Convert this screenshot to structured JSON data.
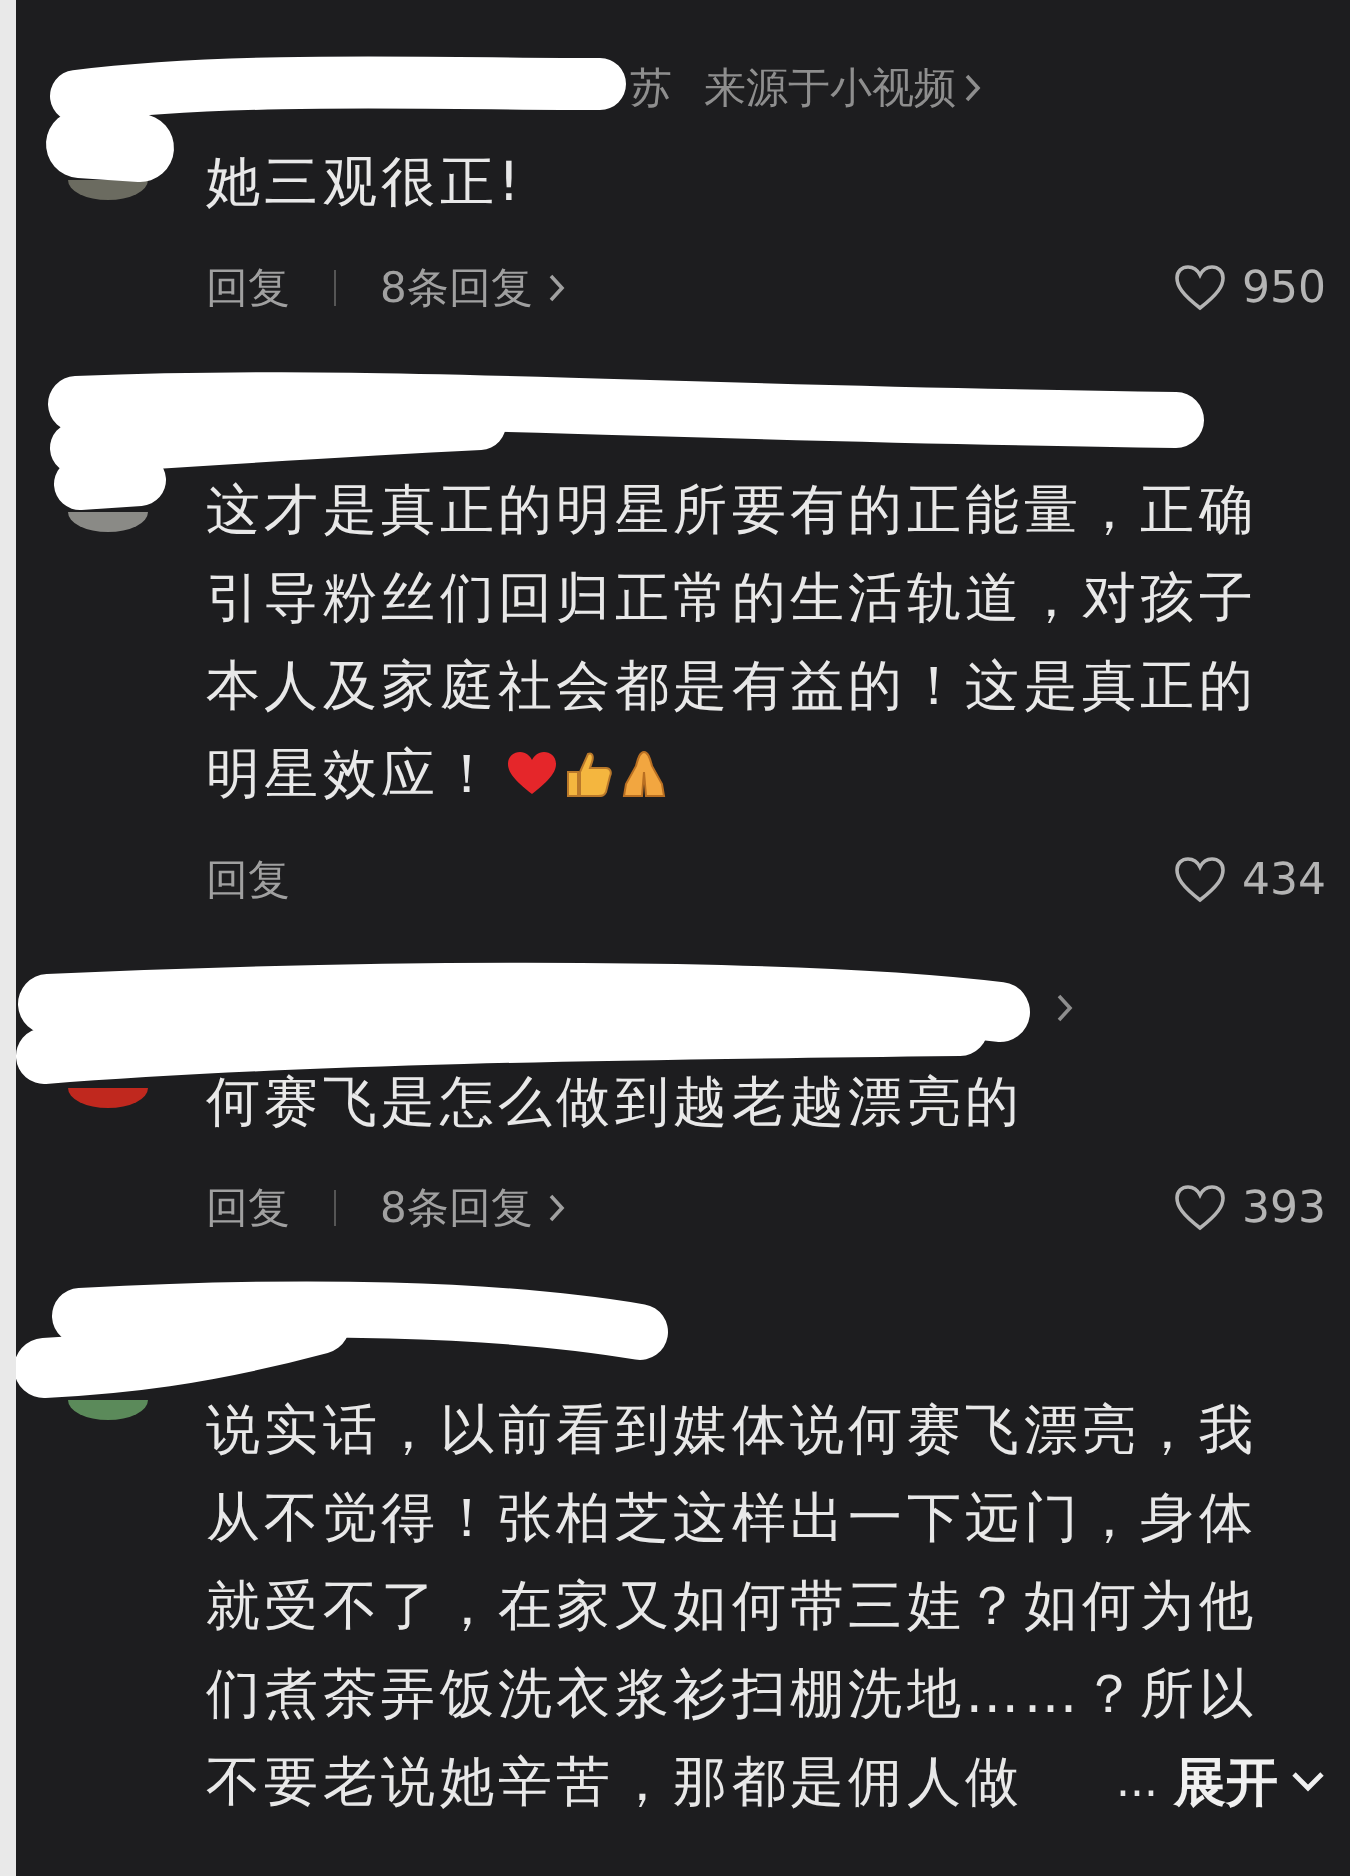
{
  "comments": [
    {
      "meta": {
        "name_fragment": "苏",
        "source": "来源于小视频",
        "has_link": true
      },
      "lines": [
        "她三观很正!"
      ],
      "actions": {
        "reply": "回复",
        "replies": "8条回复"
      },
      "likes": "950"
    },
    {
      "lines": [
        "这才是真正的明星所要有的正能量，正确",
        "引导粉丝们回归正常的生活轨道，对孩子",
        "本人及家庭社会都是有益的！这是真正的",
        "明星效应！"
      ],
      "emojis": [
        {
          "kind": "heart"
        },
        {
          "kind": "thumbs_up"
        },
        {
          "kind": "folded_hands"
        }
      ],
      "actions": {
        "reply": "回复"
      },
      "likes": "434"
    },
    {
      "meta": {
        "has_link": true
      },
      "lines": [
        "何赛飞是怎么做到越老越漂亮的"
      ],
      "actions": {
        "reply": "回复",
        "replies": "8条回复"
      },
      "likes": "393"
    },
    {
      "lines": [
        "说实话，以前看到媒体说何赛飞漂亮，我",
        "从不觉得！张柏芝这样出一下远门，身体",
        "就受不了，在家又如何带三娃？如何为他",
        "们煮茶弄饭洗衣浆衫扫棚洗地……？所以",
        "不要老说她辛苦，那都是佣人做"
      ],
      "more": {
        "ellipsis": "...",
        "label": "展开"
      }
    }
  ]
}
